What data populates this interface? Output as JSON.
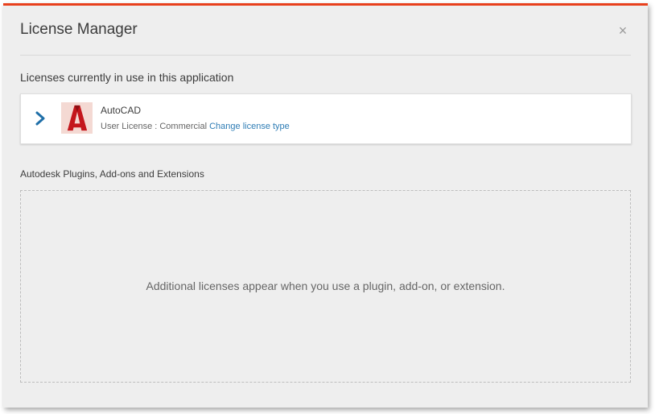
{
  "dialog": {
    "title": "License Manager",
    "close_glyph": "×",
    "accent_color": "#e8401c"
  },
  "in_use": {
    "heading": "Licenses currently in use in this application",
    "items": [
      {
        "product": "AutoCAD",
        "license_text": "User License : Commercial",
        "change_link": "Change license type",
        "icon": "autocad-logo-icon",
        "expand_icon": "chevron-right-icon"
      }
    ]
  },
  "plugins": {
    "heading": "Autodesk Plugins, Add-ons and Extensions",
    "empty_message": "Additional licenses appear when you use a plugin, add-on, or extension."
  }
}
